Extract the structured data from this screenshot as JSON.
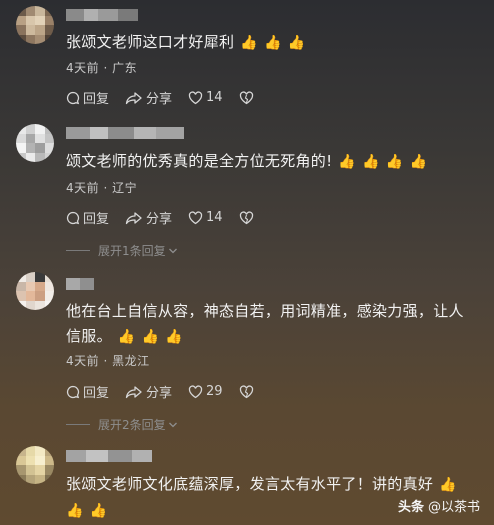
{
  "comments": [
    {
      "text": "张颂文老师这口才好犀利",
      "thumbs": [
        "👍",
        "👍",
        "👍"
      ],
      "meta": "4天前 · 广东",
      "reply_label": "回复",
      "share_label": "分享",
      "likes": "14"
    },
    {
      "text": "颂文老师的优秀真的是全方位无死角的!",
      "thumbs": [
        "👍",
        "👍",
        "👍",
        "👍"
      ],
      "meta": "4天前 · 辽宁",
      "reply_label": "回复",
      "share_label": "分享",
      "likes": "14",
      "expand_label": "展开1条回复"
    },
    {
      "text": "他在台上自信从容，神态自若，用词精准，感染力强，让人信服。",
      "thumbs": [
        "👍",
        "👍",
        "👍"
      ],
      "meta": "4天前 · 黑龙江",
      "reply_label": "回复",
      "share_label": "分享",
      "likes": "29",
      "expand_label": "展开2条回复"
    },
    {
      "text": "张颂文老师文化底蕴深厚，发言太有水平了！讲的真好",
      "thumbs": [
        "👍",
        "👍",
        "👍"
      ]
    }
  ],
  "watermark": {
    "brand": "头条",
    "handle": "@以茶书"
  },
  "colors": {
    "background": "#3a3836",
    "meta": "#c9c9c9",
    "expand": "#8e8e8e"
  },
  "icons": [
    "reply-icon",
    "share-icon",
    "heart-icon",
    "dislike-heart-icon",
    "chevron-down-icon"
  ]
}
